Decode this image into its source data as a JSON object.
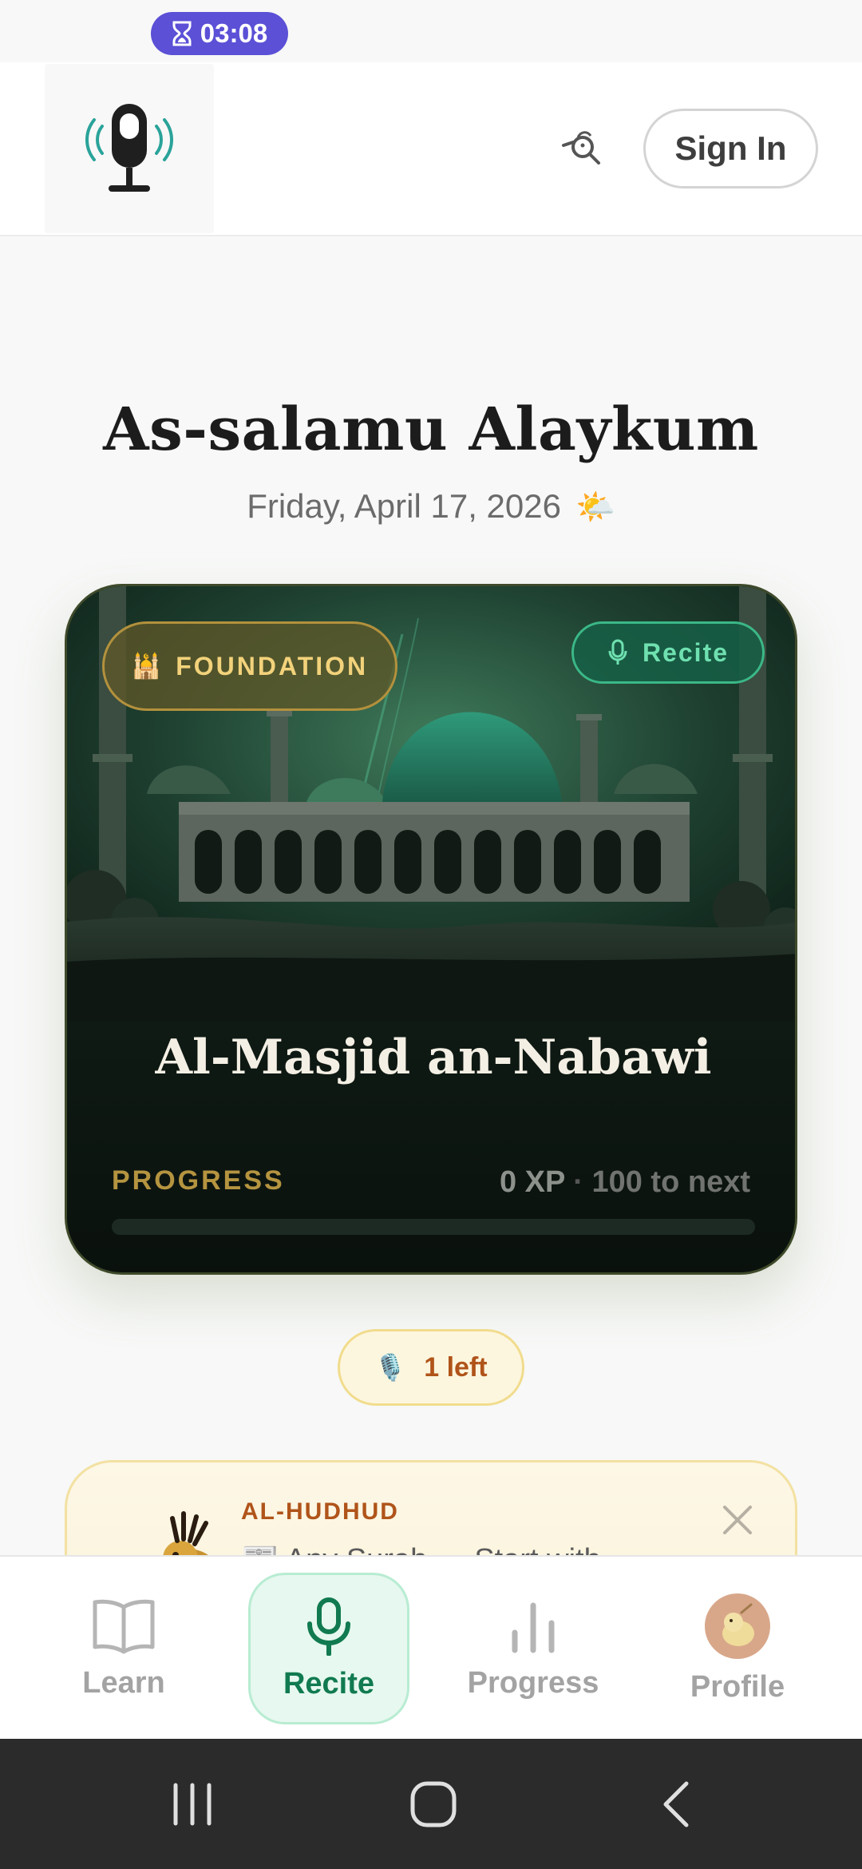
{
  "status": {
    "timer": "03:08",
    "accent": "#5b50d6"
  },
  "header": {
    "logo_icon": "microphone-broadcast-icon",
    "action_icon": "bird-search-icon",
    "sign_in_label": "Sign In"
  },
  "greeting": {
    "title": "As-salamu Alaykum",
    "date": "Friday, April 17, 2026",
    "weather_icon": "🌤️"
  },
  "hero_card": {
    "level_badge": "FOUNDATION",
    "level_icon": "🕌",
    "recite_badge": "Recite",
    "place_name": "Al-Masjid an-Nabawi",
    "progress_label": "PROGRESS",
    "xp": "0 XP",
    "separator": "·",
    "to_next": "100 to next",
    "progress_fraction": 0,
    "accent": "#b59440"
  },
  "remaining": {
    "icon": "🎙️",
    "label": "1 left"
  },
  "hudhud": {
    "title": "AL-HUDHUD",
    "message": "📰 Any Surah — Start with"
  },
  "bottom_nav": {
    "items": [
      {
        "label": "Learn",
        "icon": "book-icon"
      },
      {
        "label": "Recite",
        "icon": "microphone-icon",
        "active": true
      },
      {
        "label": "Progress",
        "icon": "bar-chart-icon"
      },
      {
        "label": "Profile",
        "icon": "avatar-icon"
      }
    ],
    "active_color": "#117a50"
  }
}
